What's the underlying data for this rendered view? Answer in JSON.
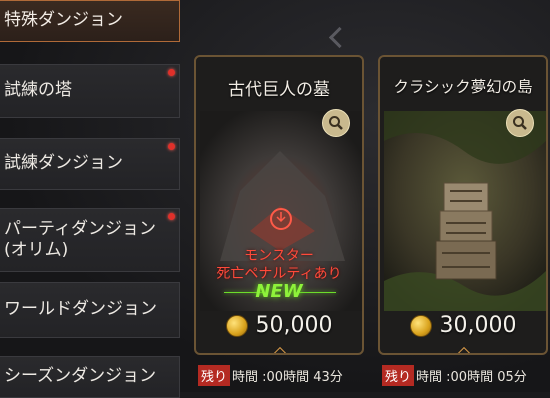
{
  "sidebar": {
    "items": [
      {
        "label": "特殊ダンジョン",
        "active": true,
        "badge": false
      },
      {
        "label": "試練の塔",
        "active": false,
        "badge": true
      },
      {
        "label": "試練ダンジョン",
        "active": false,
        "badge": true
      },
      {
        "label": "パーティダンジョン\n(オリム)",
        "active": false,
        "badge": true
      },
      {
        "label": "ワールドダンジョン",
        "active": false,
        "badge": false
      },
      {
        "label": "シーズンダンジョン",
        "active": false,
        "badge": false
      }
    ]
  },
  "cards": [
    {
      "title": "古代巨人の墓",
      "warning": "モンスター\n死亡ペナルティあり",
      "new_label": "NEW",
      "cost": "50,000",
      "time_tag": "残り",
      "time_text": "時間 :00時間 43分"
    },
    {
      "title": "クラシック夢幻の島",
      "cost": "30,000",
      "time_tag": "残り",
      "time_text": "時間 :00時間 05分"
    }
  ],
  "colors": {
    "accent_border": "#b06a38",
    "badge": "#e0302a",
    "new_green": "#8ef23a",
    "warning_red": "#ff4a3a",
    "coin_gold": "#d9a21c"
  },
  "icons": [
    "search-icon",
    "coin-icon",
    "chevron-left-icon",
    "sparkle-icon"
  ]
}
